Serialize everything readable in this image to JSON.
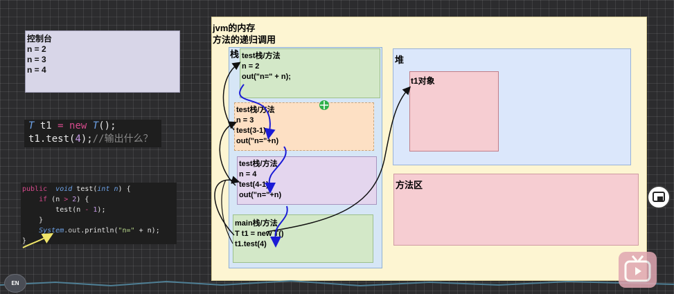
{
  "console": {
    "title": "控制台",
    "lines": [
      "n = 2",
      "n = 3",
      "n = 4"
    ]
  },
  "code_snippet": {
    "line1_type": "T",
    "line1_var": "t1",
    "line1_eq": "=",
    "line1_new": "new",
    "line1_ctor": "T",
    "line1_tail": "();",
    "line2_obj": "t1",
    "line2_call": ".test(",
    "line2_arg": "4",
    "line2_close": ");",
    "line2_comment": "//输出什么？"
  },
  "code_method": {
    "l1_public": "public",
    "l1_void": "void",
    "l1_name": "test(",
    "l1_int": "int",
    "l1_param": "n",
    "l1_close": ") {",
    "l2_if": "if",
    "l2_cond_a": "(n ",
    "l2_gt": ">",
    "l2_num": "2",
    "l2_close": ") {",
    "l3_call": "test(n ",
    "l3_minus": "-",
    "l3_num": "1",
    "l3_close": ");",
    "l4": "}",
    "l5_sys": "System",
    "l5_out": ".out",
    "l5_print": ".println(",
    "l5_str": "\"n=\"",
    "l5_plus": " + n);",
    "l6": "}"
  },
  "diagram": {
    "title": "jvm的内存",
    "subtitle": "方法的递归调用",
    "stack_label": "栈",
    "heap_label": "堆",
    "method_area_label": "方法区",
    "object_label": "t1对象",
    "frames": [
      {
        "title": "test栈/方法",
        "lines": [
          "n = 2",
          "out(\"n=\" + n);"
        ],
        "color": "#d3e8c8"
      },
      {
        "title": "test栈/方法",
        "lines": [
          "n = 3",
          "test(3-1)",
          "out(\"n=\"+n)"
        ],
        "color": "#fde0c4"
      },
      {
        "title": "test栈/方法",
        "lines": [
          "n = 4",
          "test(4-1)",
          "out(\"n=\"+n)"
        ],
        "color": "#e4d6ee"
      },
      {
        "title": "main栈/方法",
        "lines": [
          "T t1 = new T()",
          "t1.test(4)"
        ],
        "color": "#d3e8c8"
      }
    ]
  },
  "overlay": {
    "en_badge": "EN"
  },
  "icons": [
    "picture-in-picture-icon",
    "bilibili-tv-icon",
    "cursor-move-icon"
  ]
}
